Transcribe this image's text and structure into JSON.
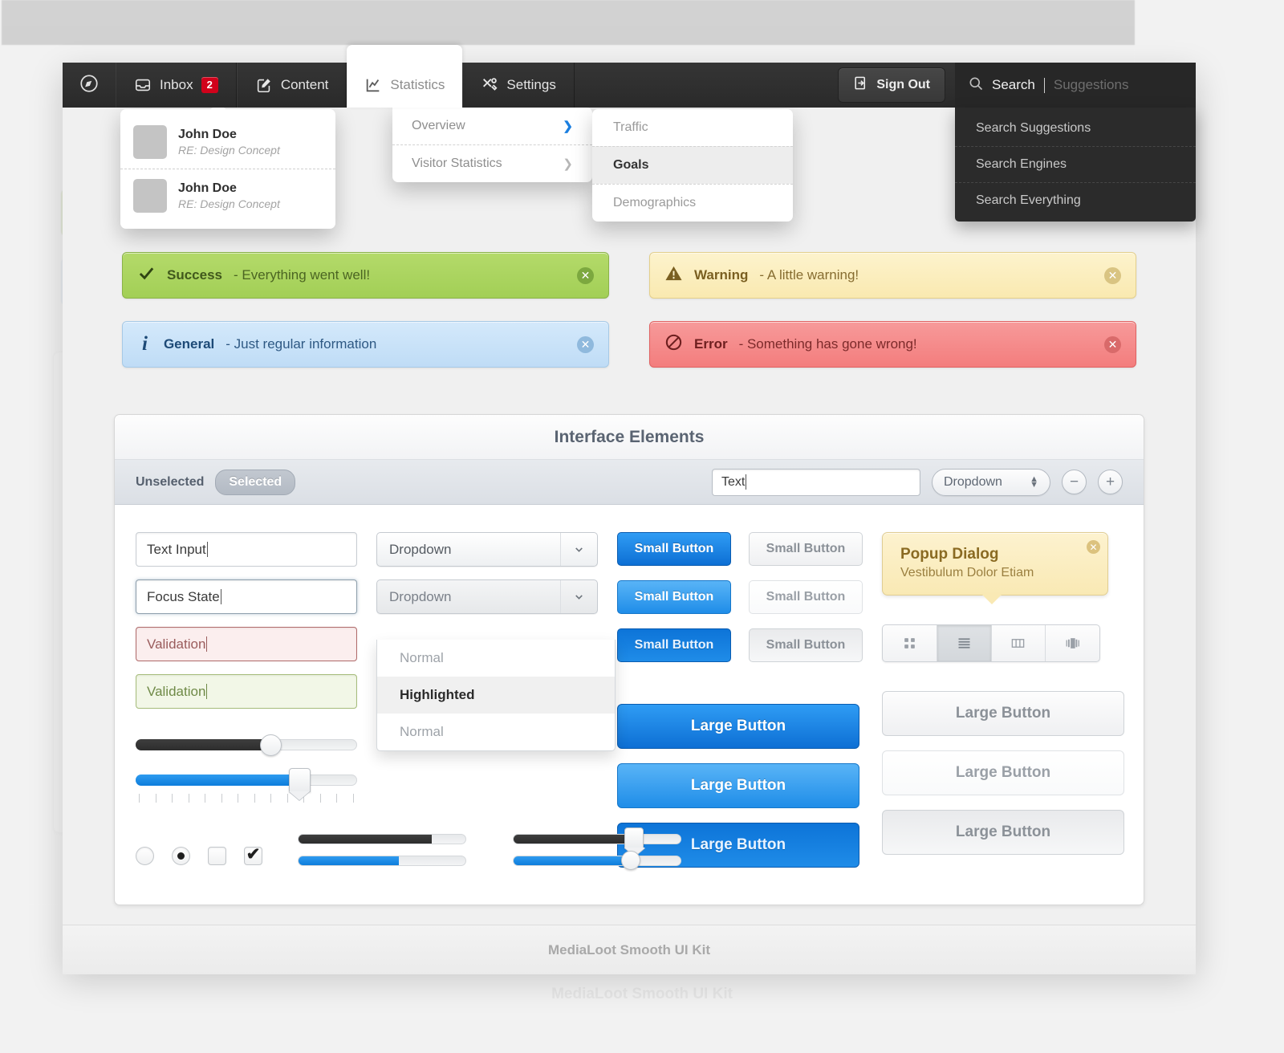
{
  "navbar": {
    "logo_icon": "compass-icon",
    "items": [
      {
        "label": "Inbox",
        "icon": "inbox-icon",
        "badge": "2"
      },
      {
        "label": "Content",
        "icon": "edit-square-icon"
      },
      {
        "label": "Statistics",
        "icon": "chart-line-icon"
      },
      {
        "label": "Settings",
        "icon": "tools-icon"
      }
    ],
    "sign_out": {
      "label": "Sign Out",
      "icon": "sign-out-icon"
    },
    "search": {
      "icon": "search-icon",
      "value": "Search",
      "placeholder": "Suggestions",
      "menu": [
        "Search Suggestions",
        "Search Engines",
        "Search Everything"
      ]
    }
  },
  "inbox_dropdown": {
    "messages": [
      {
        "name": "John Doe",
        "subject": "RE: Design Concept"
      },
      {
        "name": "John Doe",
        "subject": "RE: Design Concept"
      }
    ]
  },
  "statistics_dropdown": {
    "items": [
      {
        "label": "Overview",
        "chevron": "chevron-right-icon",
        "active": true
      },
      {
        "label": "Visitor Statistics",
        "chevron": "chevron-right-icon",
        "active": false
      }
    ]
  },
  "statistics_submenu": {
    "items": [
      {
        "label": "Traffic",
        "highlighted": false
      },
      {
        "label": "Goals",
        "highlighted": true
      },
      {
        "label": "Demographics",
        "highlighted": false
      }
    ]
  },
  "alerts": [
    {
      "type": "success",
      "icon": "check-icon",
      "title": "Success",
      "message": "- Everything went well!",
      "close_icon": "close-circle-icon"
    },
    {
      "type": "warning",
      "icon": "warning-icon",
      "title": "Warning",
      "message": "- A little warning!",
      "close_icon": "close-circle-icon"
    },
    {
      "type": "general",
      "icon": "info-icon",
      "title": "General",
      "message": "- Just regular information",
      "close_icon": "close-circle-icon"
    },
    {
      "type": "error",
      "icon": "no-entry-icon",
      "title": "Error",
      "message": "- Something has gone wrong!",
      "close_icon": "close-circle-icon"
    }
  ],
  "panel": {
    "title": "Interface Elements",
    "toolbar": {
      "unselected_label": "Unselected",
      "selected_label": "Selected",
      "text_input_value": "Text",
      "dropdown_value": "Dropdown",
      "stepper_minus": "−",
      "stepper_plus": "+"
    },
    "inputs": [
      {
        "value": "Text Input",
        "state": "normal"
      },
      {
        "value": "Focus State",
        "state": "focus"
      },
      {
        "value": "Validation",
        "state": "error"
      },
      {
        "value": "Validation",
        "state": "success"
      }
    ],
    "dropdowns": [
      {
        "value": "Dropdown",
        "open": false
      },
      {
        "value": "Dropdown",
        "open": true
      }
    ],
    "dropdown_options": [
      {
        "label": "Normal",
        "highlighted": false
      },
      {
        "label": "Highlighted",
        "highlighted": true
      },
      {
        "label": "Normal",
        "highlighted": false
      }
    ],
    "sliders": {
      "dark_value": 61,
      "blue_value": 74,
      "mini_dark_value": 80,
      "mini_blue_value": 60,
      "mini_pin_dark_value": 72,
      "mini_pin_blue_value": 70
    },
    "controls": {
      "radio_off": "radio-unchecked",
      "radio_on": "radio-checked",
      "checkbox_off": "checkbox-unchecked",
      "checkbox_on": "checkbox-checked",
      "check_glyph": "✔"
    },
    "small_buttons": [
      {
        "label": "Small Button",
        "style": "blue1"
      },
      {
        "label": "Small Button",
        "style": "gray1"
      },
      {
        "label": "Small Button",
        "style": "blue2"
      },
      {
        "label": "Small Button",
        "style": "gray2"
      },
      {
        "label": "Small Button",
        "style": "blue3"
      },
      {
        "label": "Small Button",
        "style": "gray3"
      }
    ],
    "large_buttons": [
      {
        "label": "Large Button",
        "style": "blue1"
      },
      {
        "label": "Large Button",
        "style": "gray1"
      },
      {
        "label": "Large Button",
        "style": "blue2"
      },
      {
        "label": "Large Button",
        "style": "gray2"
      },
      {
        "label": "Large Button",
        "style": "blue3"
      },
      {
        "label": "Large Button",
        "style": "gray3"
      }
    ],
    "popup": {
      "title": "Popup Dialog",
      "subtitle": "Vestibulum Dolor Etiam",
      "close_icon": "close-circle-icon"
    },
    "segmented": [
      {
        "icon": "grid-view-icon",
        "active": false
      },
      {
        "icon": "list-view-icon",
        "active": true
      },
      {
        "icon": "column-view-icon",
        "active": false
      },
      {
        "icon": "cover-flow-icon",
        "active": false
      }
    ]
  },
  "footer": {
    "text": "MediaLoot Smooth UI Kit"
  },
  "ghost_footer": {
    "text": "MediaLoot Smooth UI Kit"
  },
  "colors": {
    "navbar_bg": "#2e2e2e",
    "accent_blue": "#1f8ce8",
    "badge_red": "#d0021b",
    "success": "#a2cf56",
    "warning": "#f9e9b0",
    "general": "#bfdcf6",
    "error": "#f37d7d"
  }
}
